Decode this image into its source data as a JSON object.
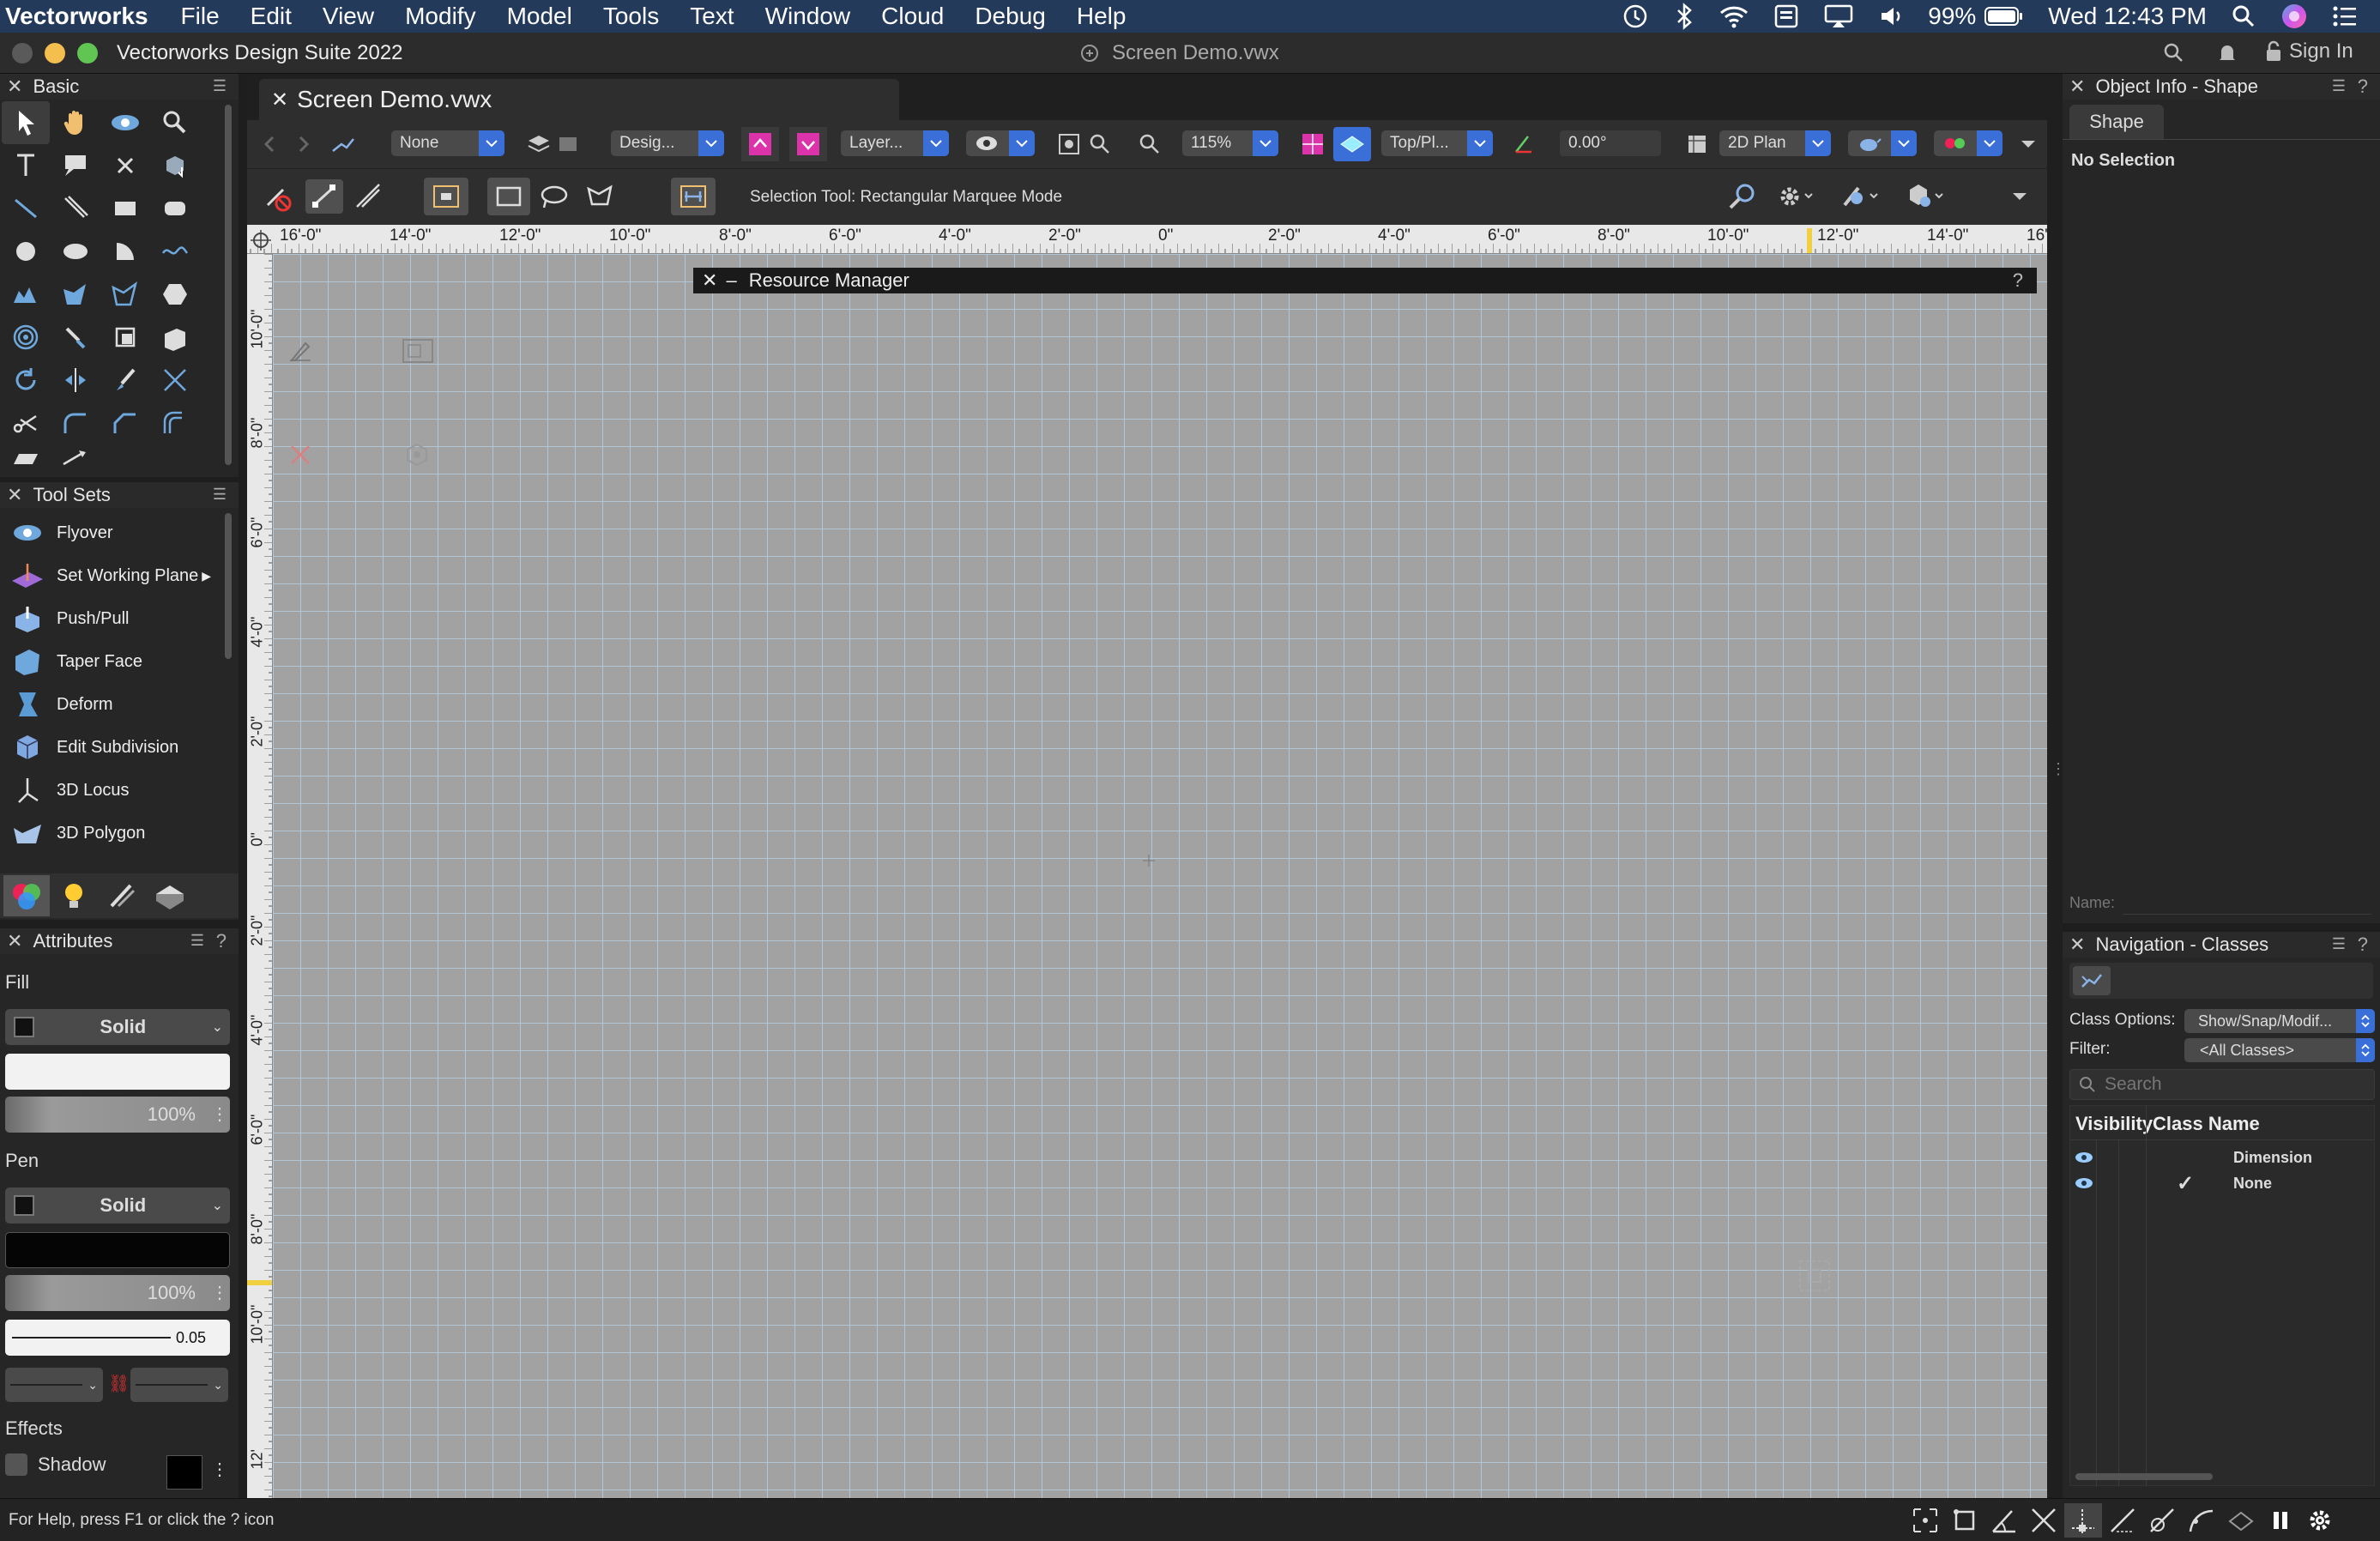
{
  "menubar": {
    "app": "Vectorworks",
    "items": [
      "File",
      "Edit",
      "View",
      "Modify",
      "Model",
      "Tools",
      "Text",
      "Window",
      "Cloud",
      "Debug",
      "Help"
    ],
    "battery": "99%",
    "clock": "Wed 12:43 PM"
  },
  "window": {
    "app_title": "Vectorworks Design Suite 2022",
    "doc_title": "Screen Demo.vwx",
    "sign_in": "Sign In"
  },
  "doc_tab": {
    "label": "Screen Demo.vwx"
  },
  "view_bar": {
    "class_value": "None",
    "design_layer": "Desig...",
    "layer": "Layer...",
    "zoom": "115%",
    "view": "Top/Pl...",
    "angle": "0.00°",
    "render_mode": "2D Plan"
  },
  "mode_bar": {
    "message": "Selection Tool: Rectangular Marquee Mode"
  },
  "rulers": {
    "top": [
      "16'-0\"",
      "14'-0\"",
      "12'-0\"",
      "10'-0\"",
      "8'-0\"",
      "6'-0\"",
      "4'-0\"",
      "2'-0\"",
      "0\"",
      "2'-0\"",
      "4'-0\"",
      "6'-0\"",
      "8'-0\"",
      "10'-0\"",
      "12'-0\"",
      "14'-0\"",
      "16'"
    ],
    "left": [
      "10'-0\"",
      "8'-0\"",
      "6'-0\"",
      "4'-0\"",
      "2'-0\"",
      "0\"",
      "2'-0\"",
      "4'-0\"",
      "6'-0\"",
      "8'-0\"",
      "10'-0\"",
      "12'"
    ]
  },
  "basic_palette": {
    "title": "Basic"
  },
  "tool_sets": {
    "title": "Tool Sets",
    "items": [
      {
        "label": "Flyover",
        "icon": "flyover-icon"
      },
      {
        "label": "Set Working Plane",
        "icon": "working-plane-icon"
      },
      {
        "label": "Push/Pull",
        "icon": "push-pull-icon"
      },
      {
        "label": "Taper Face",
        "icon": "taper-face-icon"
      },
      {
        "label": "Deform",
        "icon": "deform-icon"
      },
      {
        "label": "Edit Subdivision",
        "icon": "edit-subdivision-icon"
      },
      {
        "label": "3D Locus",
        "icon": "locus-icon"
      },
      {
        "label": "3D Polygon",
        "icon": "polygon-3d-icon"
      }
    ]
  },
  "attributes": {
    "title": "Attributes",
    "fill_label": "Fill",
    "fill_style": "Solid",
    "fill_opacity": "100%",
    "pen_label": "Pen",
    "pen_style": "Solid",
    "pen_opacity": "100%",
    "line_weight": "0.05",
    "effects_label": "Effects",
    "shadow_label": "Shadow"
  },
  "resource_manager": {
    "title": "Resource Manager",
    "help": "?"
  },
  "object_info": {
    "title": "Object Info - Shape",
    "tab": "Shape",
    "selection": "No Selection",
    "name_label": "Name:"
  },
  "navigation": {
    "title": "Navigation - Classes",
    "class_options_label": "Class Options:",
    "class_options_value": "Show/Snap/Modif...",
    "filter_label": "Filter:",
    "filter_value": "<All Classes>",
    "search_placeholder": "Search",
    "col_visibility": "Visibility",
    "col_class_name": "Class Name",
    "rows": [
      {
        "name": "Dimension",
        "active": false
      },
      {
        "name": "None",
        "active": true
      }
    ],
    "check": "✓"
  },
  "status_bar": {
    "help_text": "For Help, press F1 or click the ? icon"
  },
  "colors": {
    "menubar": "#233a5a",
    "canvas": "#a2a2a2",
    "accent": "#3a6fd8"
  }
}
